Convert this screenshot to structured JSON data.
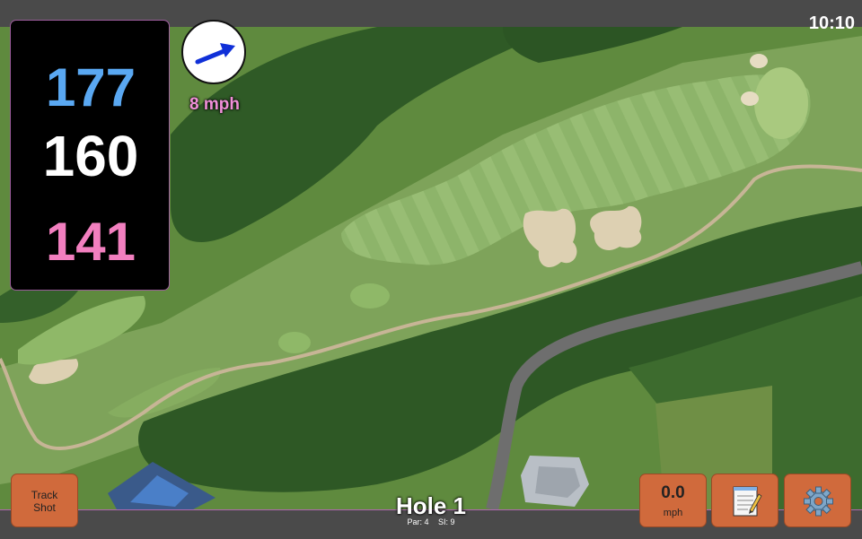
{
  "status_bar": {
    "time": "10:10"
  },
  "distances": {
    "back": "177",
    "middle": "160",
    "front": "141"
  },
  "wind": {
    "speed_label": "8 mph",
    "direction_icon": "wind-arrow-icon"
  },
  "hole": {
    "title": "Hole 1",
    "par": "Par: 4",
    "stroke_index": "SI: 9"
  },
  "buttons": {
    "track_shot": [
      "Track",
      "Shot"
    ],
    "wind_value": "0.0",
    "wind_unit": "mph",
    "notes_icon": "notepad-icon",
    "settings_icon": "gear-icon"
  },
  "colors": {
    "back_distance": "#5aa8f2",
    "middle_distance": "#ffffff",
    "front_distance": "#f27fbf",
    "button": "#d06a3c",
    "accent_border": "#b067b0"
  }
}
